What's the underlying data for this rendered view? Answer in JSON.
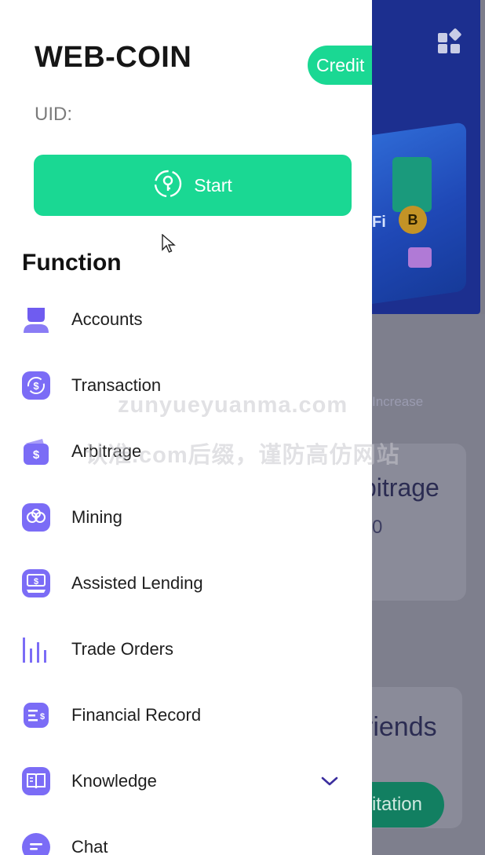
{
  "drawer": {
    "brand": "WEB-COIN",
    "credit_label": "Credit",
    "uid_label": "UID:",
    "start_label": "Start",
    "section_title": "Function",
    "items": [
      {
        "label": "Accounts",
        "icon": "user-icon"
      },
      {
        "label": "Transaction",
        "icon": "transaction-icon"
      },
      {
        "label": "Arbitrage",
        "icon": "wallet-icon"
      },
      {
        "label": "Mining",
        "icon": "mining-icon"
      },
      {
        "label": "Assisted Lending",
        "icon": "lending-icon"
      },
      {
        "label": "Trade Orders",
        "icon": "bar-chart-icon"
      },
      {
        "label": "Financial Record",
        "icon": "record-icon"
      },
      {
        "label": "Knowledge",
        "icon": "book-icon",
        "expandable": true
      },
      {
        "label": "Chat",
        "icon": "chat-icon"
      }
    ]
  },
  "background": {
    "increase_label": "Increase",
    "card1_title": "bitrage",
    "card1_value": "0",
    "card2_title": "riends",
    "invite_button": "itation",
    "coin_symbol": "B",
    "fi_text": "Fi"
  },
  "watermark": {
    "line1": "zunyueyuanma.com",
    "line2": "认准.com后缀，谨防高仿网站"
  },
  "colors": {
    "accent": "#1ad893",
    "icon_purple": "#7b6cf6",
    "chevron": "#3b2e9e",
    "overlay_bg": "#7e7f8e",
    "hero_blue": "#1c2f8f"
  }
}
